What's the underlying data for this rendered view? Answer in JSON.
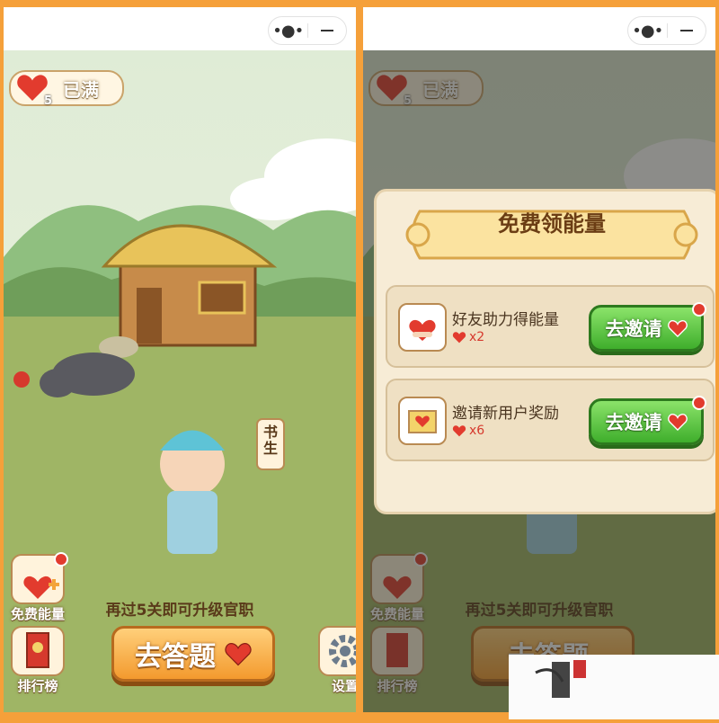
{
  "hearts": {
    "count": "5",
    "status": "已满"
  },
  "sign": {
    "text": "书生"
  },
  "left": {
    "free_energy_label": "免费能量",
    "rank_label": "排行榜",
    "settings_label": "设置",
    "promo_text": "再过5关即可升级官职",
    "answer_button": "去答题"
  },
  "modal": {
    "title": "免费领能量",
    "items": [
      {
        "title": "好友助力得能量",
        "reward": "x2",
        "button": "去邀请"
      },
      {
        "title": "邀请新用户奖励",
        "reward": "x6",
        "button": "去邀请"
      }
    ]
  },
  "colors": {
    "accent": "#f39a2e",
    "heart": "#e23b2e",
    "invite": "#3fae2c"
  }
}
